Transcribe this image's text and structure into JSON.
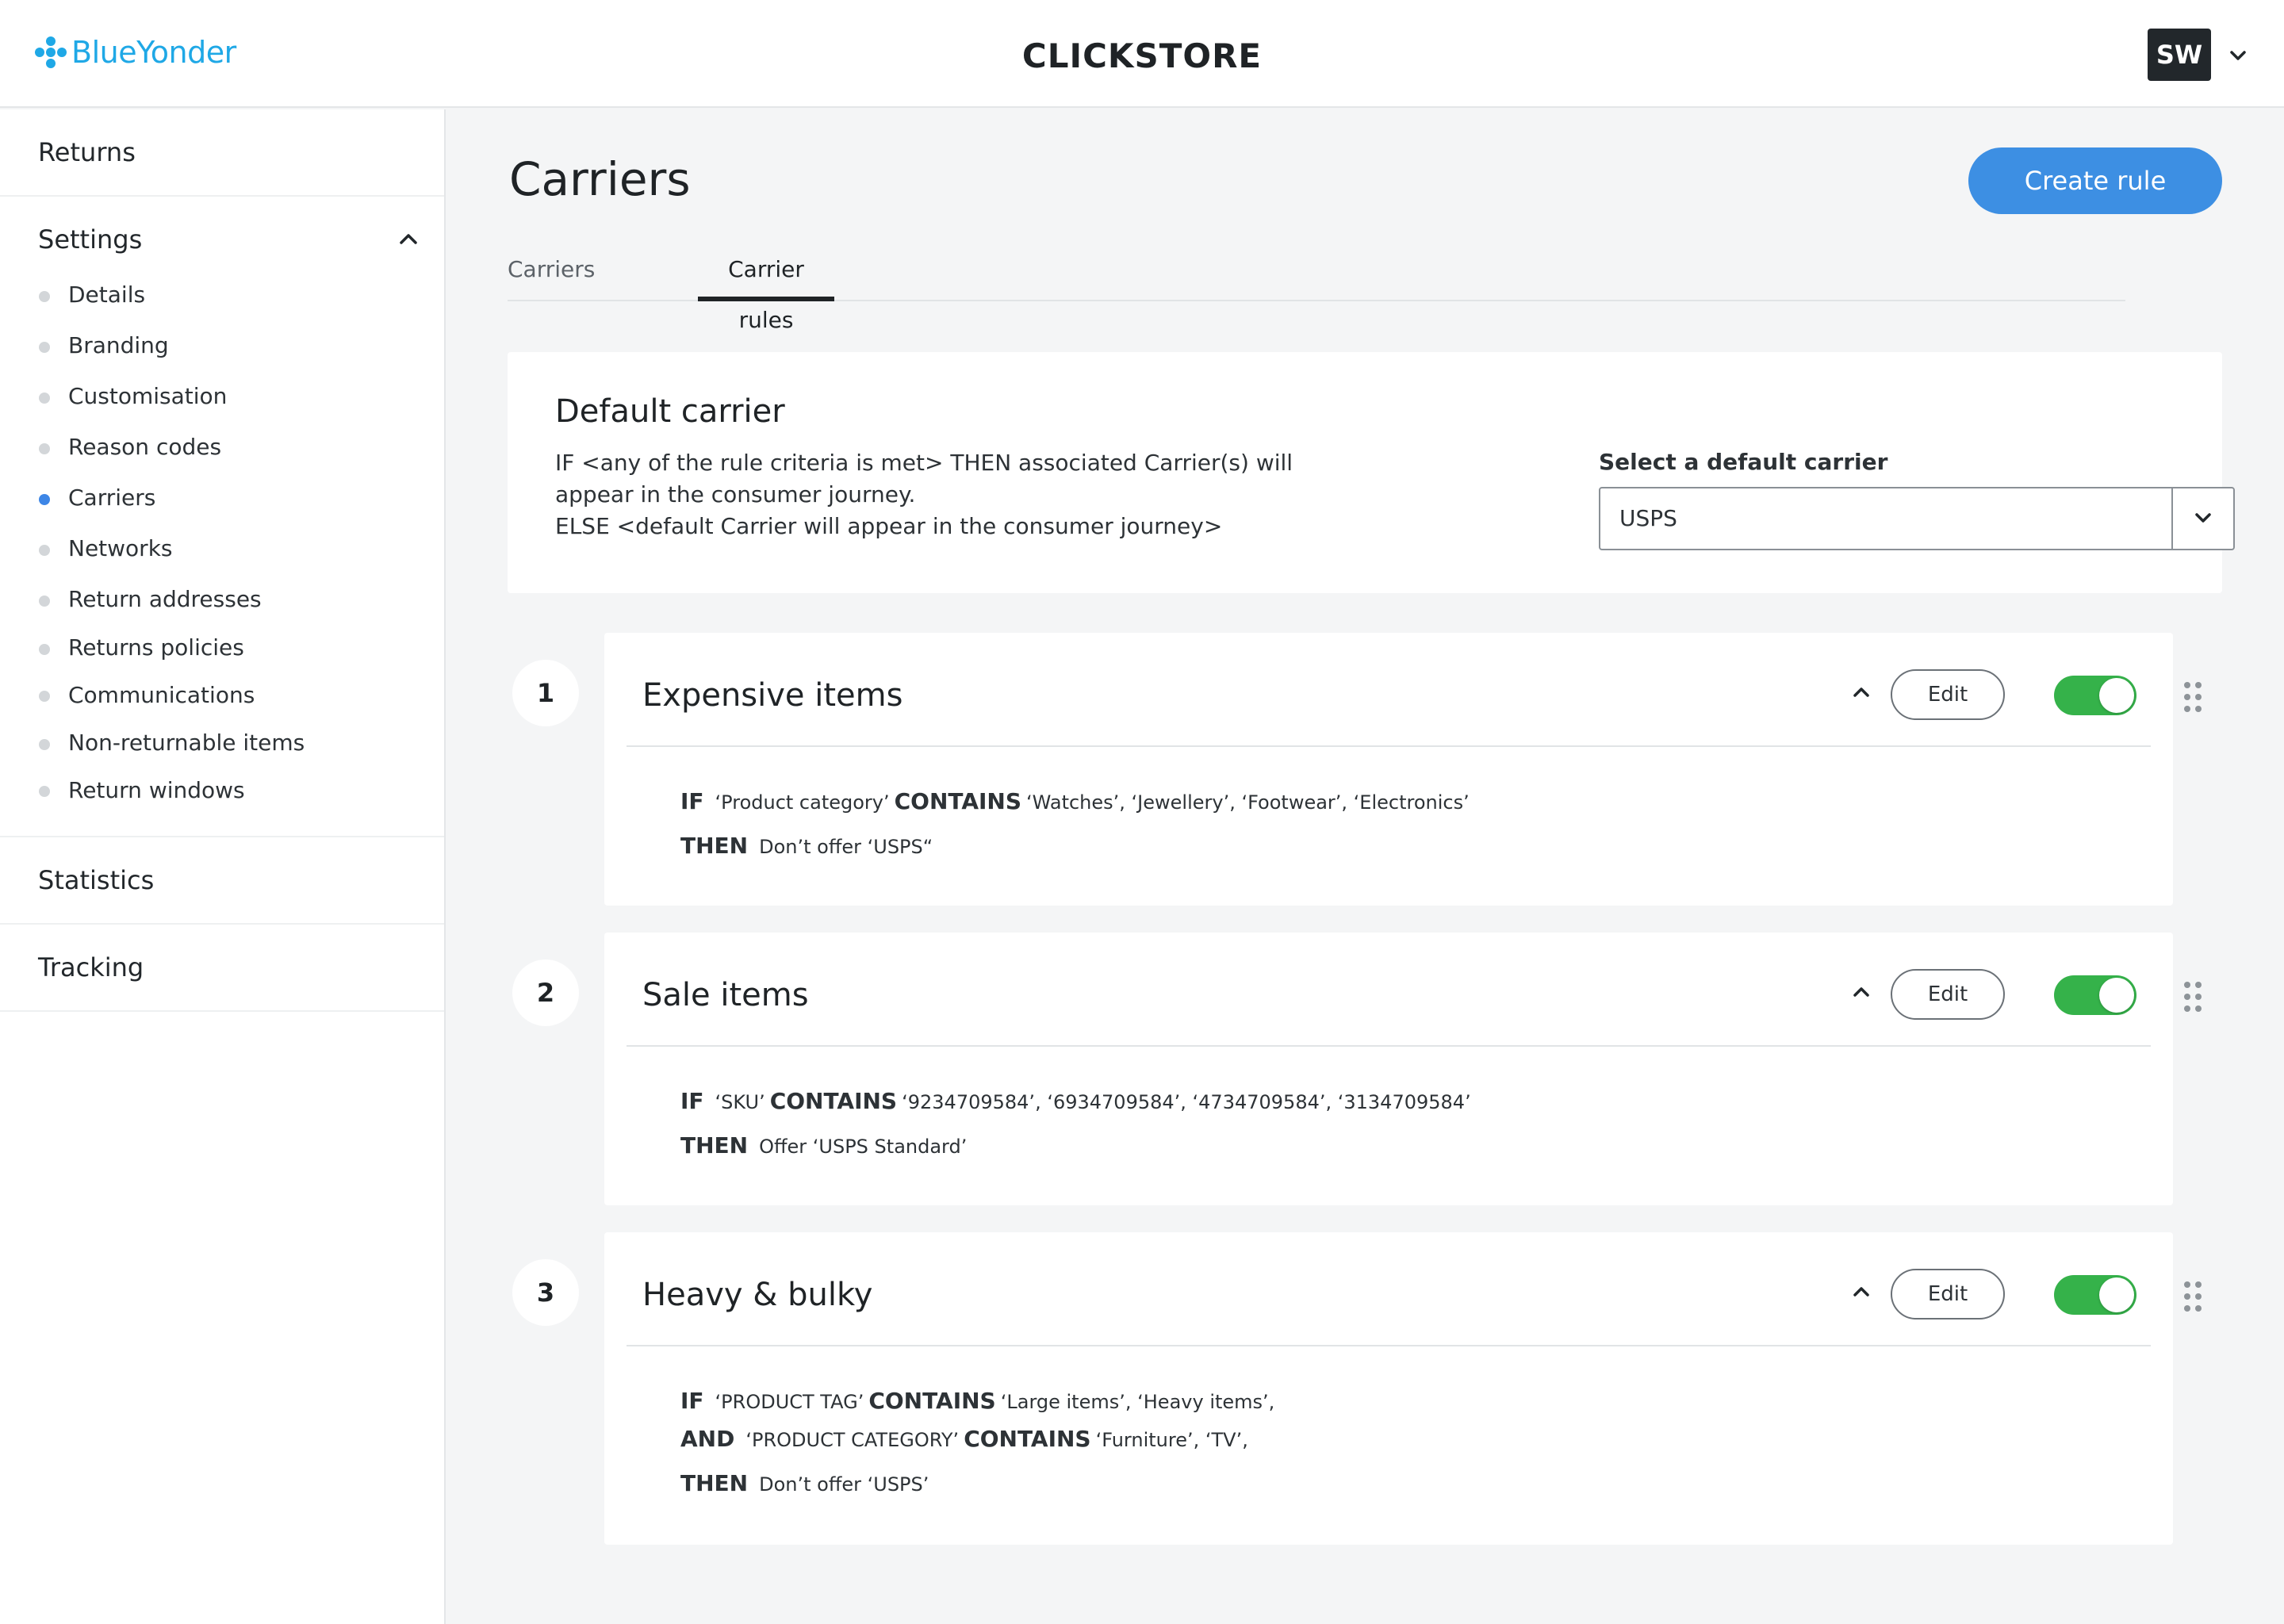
{
  "header": {
    "logo_text": "BlueYonder",
    "store_name": "CLICKSTORE",
    "avatar_initials": "SW"
  },
  "sidebar": {
    "returns": "Returns",
    "settings": "Settings",
    "settings_items": [
      "Details",
      "Branding",
      "Customisation",
      "Reason codes",
      "Carriers",
      "Networks",
      "Return addresses",
      "Returns policies",
      "Communications",
      "Non-returnable items",
      "Return windows"
    ],
    "active_item": "Carriers",
    "statistics": "Statistics",
    "tracking": "Tracking"
  },
  "main": {
    "page_title": "Carriers",
    "create_rule_label": "Create rule",
    "tabs": [
      {
        "label": "Carriers",
        "active": false
      },
      {
        "label": "Carrier rules",
        "active": true
      }
    ],
    "default_carrier": {
      "title": "Default carrier",
      "desc_line1": "IF <any of the rule criteria is met> THEN associated Carrier(s) will",
      "desc_line2": "appear in the consumer journey.",
      "desc_line3": "ELSE <default Carrier will appear in the consumer journey>",
      "select_label": "Select a default carrier",
      "select_value": "USPS"
    },
    "edit_label": "Edit",
    "rules": [
      {
        "number": "1",
        "title": "Expensive items",
        "enabled": true,
        "lines": [
          {
            "kw": "IF",
            "field": "‘Product category’",
            "op": "CONTAINS",
            "values": "‘Watches’, ‘Jewellery’, ‘Footwear’, ‘Electronics’"
          },
          {
            "kw": "THEN",
            "text": "Don’t offer ‘USPS“"
          }
        ]
      },
      {
        "number": "2",
        "title": "Sale items",
        "enabled": true,
        "lines": [
          {
            "kw": "IF",
            "field": "‘SKU’",
            "op": "CONTAINS",
            "values": "‘9234709584’, ‘6934709584’, ‘4734709584’, ‘3134709584’"
          },
          {
            "kw": "THEN",
            "text": "Offer ‘USPS Standard’"
          }
        ]
      },
      {
        "number": "3",
        "title": "Heavy & bulky",
        "enabled": true,
        "lines": [
          {
            "kw": "IF",
            "field": "‘PRODUCT TAG’",
            "op": "CONTAINS",
            "values": "‘Large items’, ‘Heavy items’,"
          },
          {
            "kw": "AND",
            "field": "‘PRODUCT CATEGORY’",
            "op": "CONTAINS",
            "values": "‘Furniture’, ‘TV’,"
          },
          {
            "kw": "THEN",
            "text": "Don’t offer ‘USPS’"
          }
        ]
      }
    ]
  }
}
